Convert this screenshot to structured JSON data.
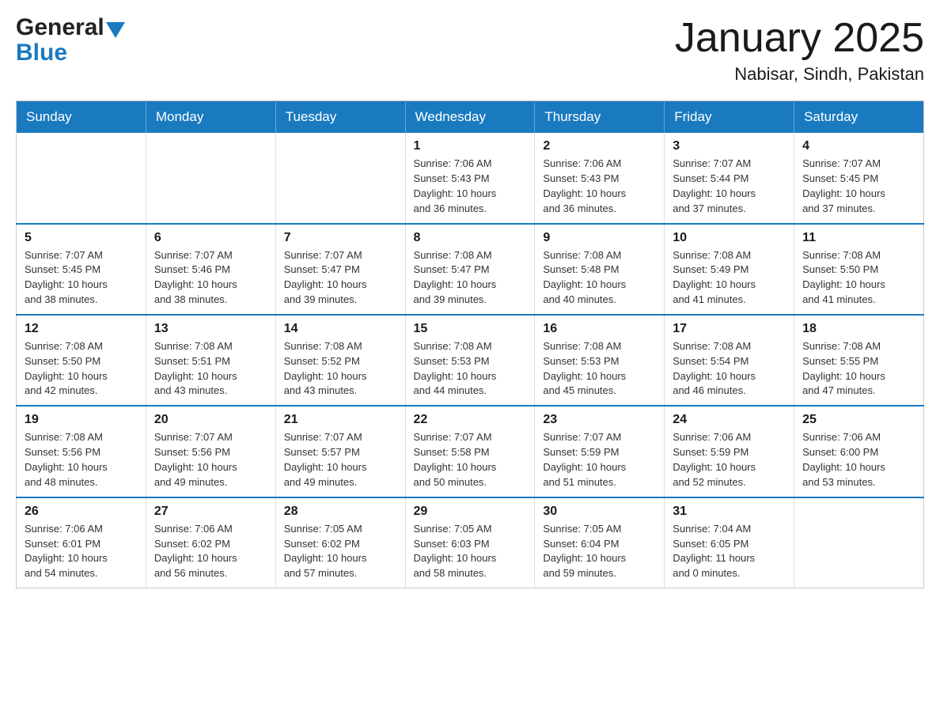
{
  "header": {
    "logo": {
      "general": "General",
      "blue": "Blue"
    },
    "title": "January 2025",
    "location": "Nabisar, Sindh, Pakistan"
  },
  "calendar": {
    "weekdays": [
      "Sunday",
      "Monday",
      "Tuesday",
      "Wednesday",
      "Thursday",
      "Friday",
      "Saturday"
    ],
    "weeks": [
      [
        {
          "day": "",
          "info": ""
        },
        {
          "day": "",
          "info": ""
        },
        {
          "day": "",
          "info": ""
        },
        {
          "day": "1",
          "info": "Sunrise: 7:06 AM\nSunset: 5:43 PM\nDaylight: 10 hours\nand 36 minutes."
        },
        {
          "day": "2",
          "info": "Sunrise: 7:06 AM\nSunset: 5:43 PM\nDaylight: 10 hours\nand 36 minutes."
        },
        {
          "day": "3",
          "info": "Sunrise: 7:07 AM\nSunset: 5:44 PM\nDaylight: 10 hours\nand 37 minutes."
        },
        {
          "day": "4",
          "info": "Sunrise: 7:07 AM\nSunset: 5:45 PM\nDaylight: 10 hours\nand 37 minutes."
        }
      ],
      [
        {
          "day": "5",
          "info": "Sunrise: 7:07 AM\nSunset: 5:45 PM\nDaylight: 10 hours\nand 38 minutes."
        },
        {
          "day": "6",
          "info": "Sunrise: 7:07 AM\nSunset: 5:46 PM\nDaylight: 10 hours\nand 38 minutes."
        },
        {
          "day": "7",
          "info": "Sunrise: 7:07 AM\nSunset: 5:47 PM\nDaylight: 10 hours\nand 39 minutes."
        },
        {
          "day": "8",
          "info": "Sunrise: 7:08 AM\nSunset: 5:47 PM\nDaylight: 10 hours\nand 39 minutes."
        },
        {
          "day": "9",
          "info": "Sunrise: 7:08 AM\nSunset: 5:48 PM\nDaylight: 10 hours\nand 40 minutes."
        },
        {
          "day": "10",
          "info": "Sunrise: 7:08 AM\nSunset: 5:49 PM\nDaylight: 10 hours\nand 41 minutes."
        },
        {
          "day": "11",
          "info": "Sunrise: 7:08 AM\nSunset: 5:50 PM\nDaylight: 10 hours\nand 41 minutes."
        }
      ],
      [
        {
          "day": "12",
          "info": "Sunrise: 7:08 AM\nSunset: 5:50 PM\nDaylight: 10 hours\nand 42 minutes."
        },
        {
          "day": "13",
          "info": "Sunrise: 7:08 AM\nSunset: 5:51 PM\nDaylight: 10 hours\nand 43 minutes."
        },
        {
          "day": "14",
          "info": "Sunrise: 7:08 AM\nSunset: 5:52 PM\nDaylight: 10 hours\nand 43 minutes."
        },
        {
          "day": "15",
          "info": "Sunrise: 7:08 AM\nSunset: 5:53 PM\nDaylight: 10 hours\nand 44 minutes."
        },
        {
          "day": "16",
          "info": "Sunrise: 7:08 AM\nSunset: 5:53 PM\nDaylight: 10 hours\nand 45 minutes."
        },
        {
          "day": "17",
          "info": "Sunrise: 7:08 AM\nSunset: 5:54 PM\nDaylight: 10 hours\nand 46 minutes."
        },
        {
          "day": "18",
          "info": "Sunrise: 7:08 AM\nSunset: 5:55 PM\nDaylight: 10 hours\nand 47 minutes."
        }
      ],
      [
        {
          "day": "19",
          "info": "Sunrise: 7:08 AM\nSunset: 5:56 PM\nDaylight: 10 hours\nand 48 minutes."
        },
        {
          "day": "20",
          "info": "Sunrise: 7:07 AM\nSunset: 5:56 PM\nDaylight: 10 hours\nand 49 minutes."
        },
        {
          "day": "21",
          "info": "Sunrise: 7:07 AM\nSunset: 5:57 PM\nDaylight: 10 hours\nand 49 minutes."
        },
        {
          "day": "22",
          "info": "Sunrise: 7:07 AM\nSunset: 5:58 PM\nDaylight: 10 hours\nand 50 minutes."
        },
        {
          "day": "23",
          "info": "Sunrise: 7:07 AM\nSunset: 5:59 PM\nDaylight: 10 hours\nand 51 minutes."
        },
        {
          "day": "24",
          "info": "Sunrise: 7:06 AM\nSunset: 5:59 PM\nDaylight: 10 hours\nand 52 minutes."
        },
        {
          "day": "25",
          "info": "Sunrise: 7:06 AM\nSunset: 6:00 PM\nDaylight: 10 hours\nand 53 minutes."
        }
      ],
      [
        {
          "day": "26",
          "info": "Sunrise: 7:06 AM\nSunset: 6:01 PM\nDaylight: 10 hours\nand 54 minutes."
        },
        {
          "day": "27",
          "info": "Sunrise: 7:06 AM\nSunset: 6:02 PM\nDaylight: 10 hours\nand 56 minutes."
        },
        {
          "day": "28",
          "info": "Sunrise: 7:05 AM\nSunset: 6:02 PM\nDaylight: 10 hours\nand 57 minutes."
        },
        {
          "day": "29",
          "info": "Sunrise: 7:05 AM\nSunset: 6:03 PM\nDaylight: 10 hours\nand 58 minutes."
        },
        {
          "day": "30",
          "info": "Sunrise: 7:05 AM\nSunset: 6:04 PM\nDaylight: 10 hours\nand 59 minutes."
        },
        {
          "day": "31",
          "info": "Sunrise: 7:04 AM\nSunset: 6:05 PM\nDaylight: 11 hours\nand 0 minutes."
        },
        {
          "day": "",
          "info": ""
        }
      ]
    ]
  }
}
